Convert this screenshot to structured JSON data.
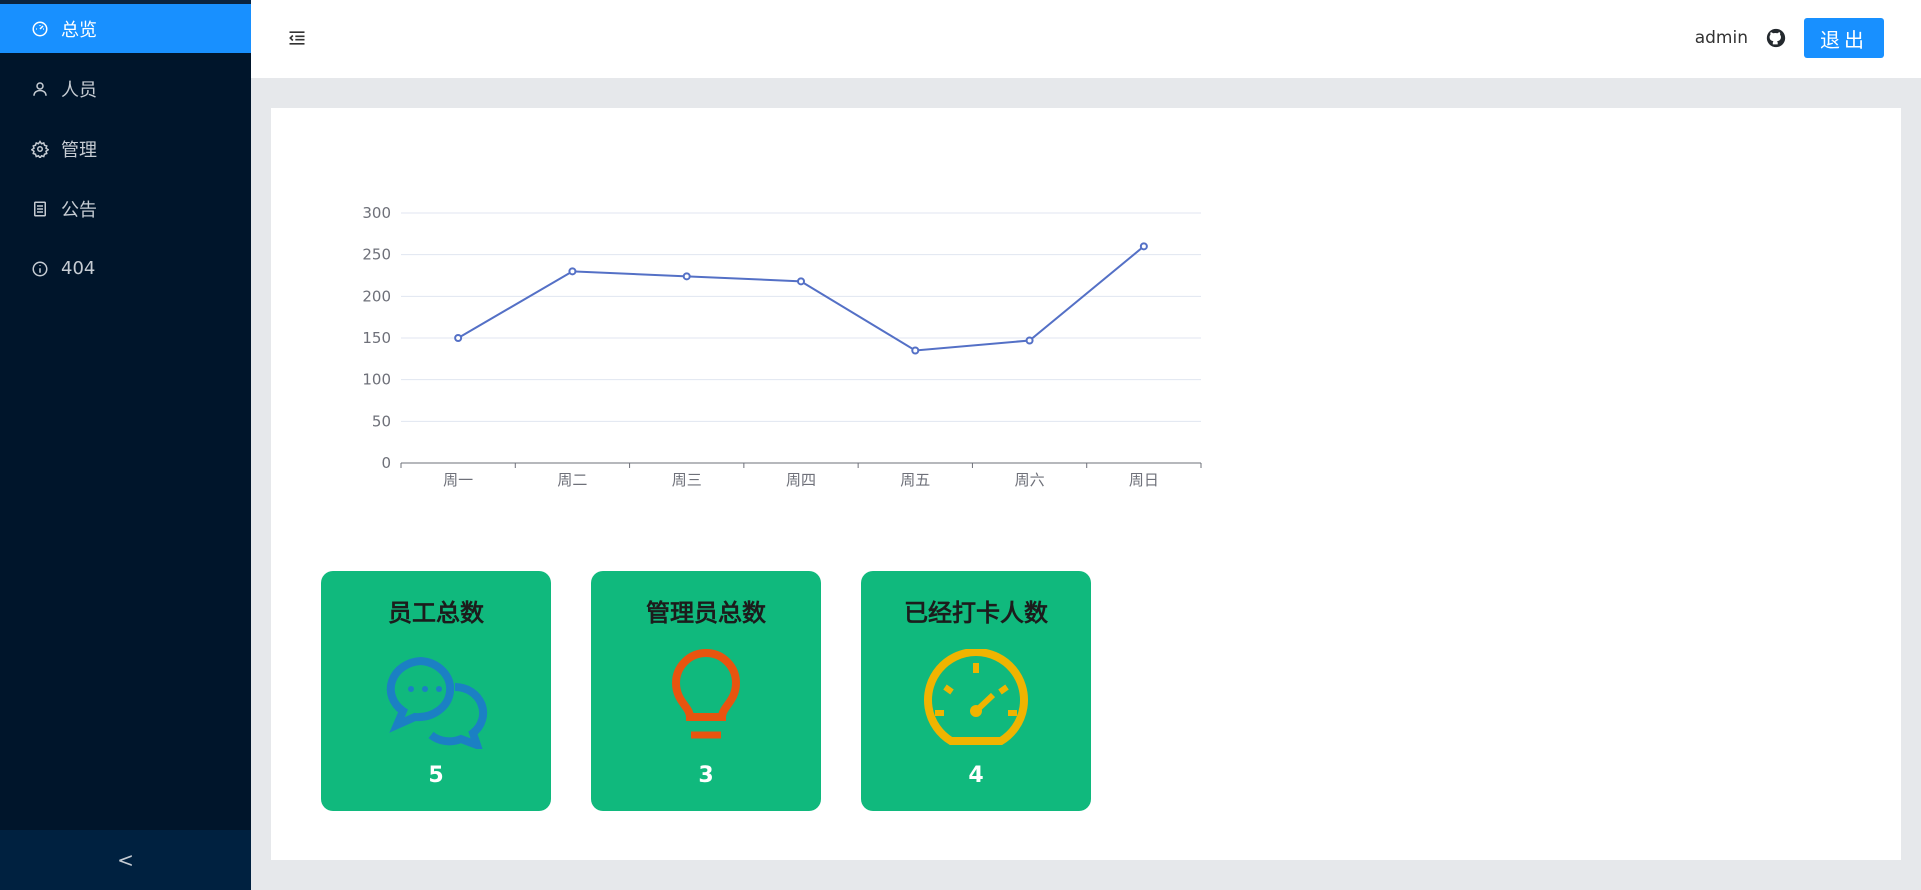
{
  "sidebar": {
    "items": [
      {
        "label": "总览",
        "icon": "dashboard-icon",
        "active": true
      },
      {
        "label": "人员",
        "icon": "user-icon",
        "active": false
      },
      {
        "label": "管理",
        "icon": "gear-icon",
        "active": false
      },
      {
        "label": "公告",
        "icon": "document-icon",
        "active": false
      },
      {
        "label": "404",
        "icon": "info-icon",
        "active": false
      }
    ],
    "collapse_label": "<"
  },
  "header": {
    "username": "admin",
    "logout_label": "退出",
    "github_icon": "github-icon",
    "menu_icon": "menu-fold-icon"
  },
  "colors": {
    "sidebar_bg": "#00152b",
    "accent": "#1890ff",
    "card_green": "#10b97d",
    "line": "#5470c6"
  },
  "chart_data": {
    "type": "line",
    "categories": [
      "周一",
      "周二",
      "周三",
      "周四",
      "周五",
      "周六",
      "周日"
    ],
    "values": [
      150,
      230,
      224,
      218,
      135,
      147,
      260
    ],
    "ylim": [
      0,
      300
    ],
    "yticks": [
      0,
      50,
      100,
      150,
      200,
      250,
      300
    ],
    "grid": true,
    "title": "",
    "xlabel": "",
    "ylabel": ""
  },
  "stats": [
    {
      "title": "员工总数",
      "value": "5",
      "icon": "chat-icon",
      "icon_color": "#1b80c4"
    },
    {
      "title": "管理员总数",
      "value": "3",
      "icon": "lightbulb-icon",
      "icon_color": "#e8540f"
    },
    {
      "title": "已经打卡人数",
      "value": "4",
      "icon": "speedometer-icon",
      "icon_color": "#f0b400"
    }
  ]
}
